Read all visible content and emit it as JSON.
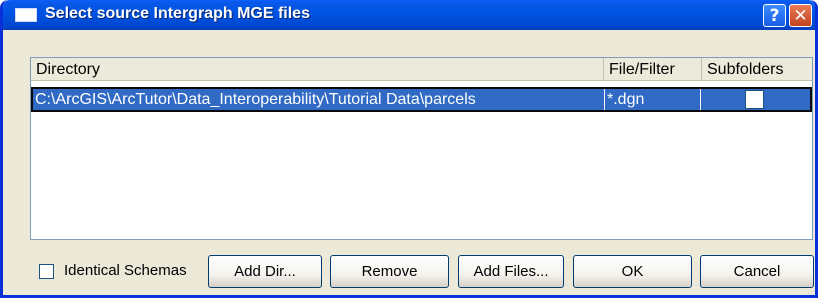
{
  "window": {
    "title": "Select source Intergraph MGE files",
    "help_glyph": "?",
    "close_glyph": "✕"
  },
  "list": {
    "columns": [
      "Directory",
      "File/Filter",
      "Subfolders"
    ],
    "rows": [
      {
        "directory": "C:\\ArcGIS\\ArcTutor\\Data_Interoperability\\Tutorial Data\\parcels",
        "filter": "*.dgn",
        "subfolders_checked": false,
        "selected": true
      }
    ]
  },
  "options": {
    "identical_schemas_label": "Identical Schemas",
    "identical_schemas_checked": false
  },
  "buttons": {
    "add_dir": "Add Dir...",
    "remove": "Remove",
    "add_files": "Add Files...",
    "ok": "OK",
    "cancel": "Cancel"
  },
  "colors": {
    "titlebar": "#0054e3",
    "selection": "#316ac5",
    "dialog_face": "#ece9d8",
    "close_button": "#c2431c"
  },
  "icons": {
    "title": "dialog-window-icon",
    "help": "help-icon",
    "close": "close-icon"
  }
}
